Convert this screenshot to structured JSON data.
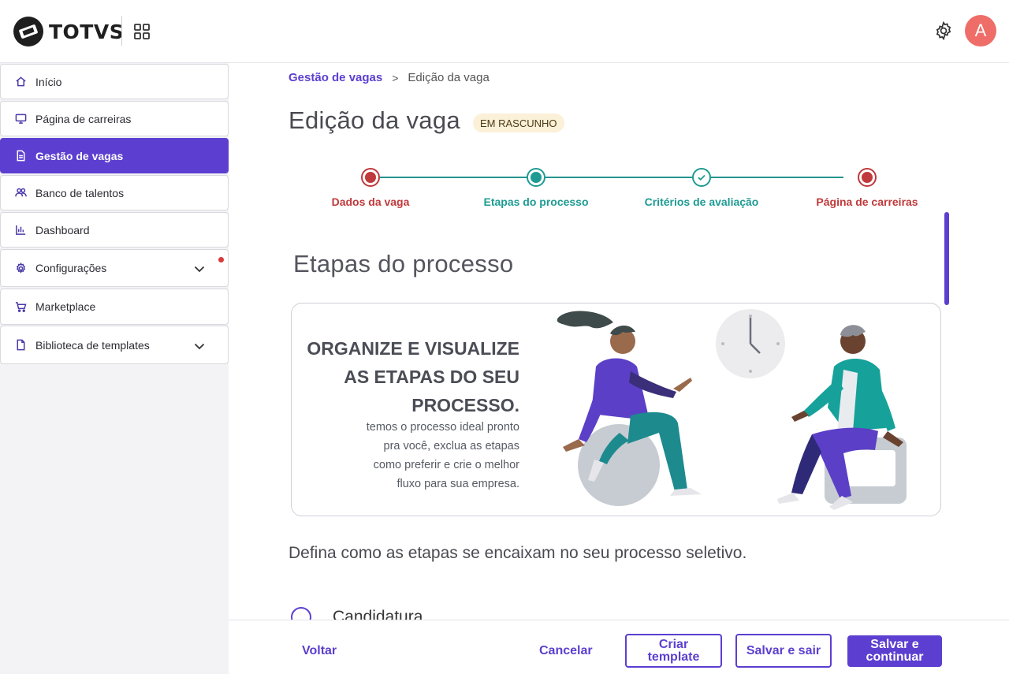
{
  "header": {
    "brand": "TOTVS",
    "avatar_initial": "A"
  },
  "sidebar": {
    "items": [
      {
        "label": "Início",
        "icon": "home-icon"
      },
      {
        "label": "Página de carreiras",
        "icon": "monitor-icon"
      },
      {
        "label": "Gestão de vagas",
        "icon": "document-icon",
        "active": true
      },
      {
        "label": "Banco de talentos",
        "icon": "people-icon"
      },
      {
        "label": "Dashboard",
        "icon": "bar-chart-icon"
      },
      {
        "label": "Configurações",
        "icon": "gear-icon",
        "expandable": true,
        "notification": true
      },
      {
        "label": "Marketplace",
        "icon": "cart-icon"
      },
      {
        "label": "Biblioteca de templates",
        "icon": "file-icon",
        "expandable": true
      }
    ]
  },
  "breadcrumb": {
    "parent": "Gestão de vagas",
    "separator": ">",
    "current": "Edição da vaga"
  },
  "page": {
    "title": "Edição da vaga",
    "status": "EM RASCUNHO"
  },
  "stepper": {
    "steps": [
      {
        "label": "Dados da vaga",
        "state": "error",
        "color": "#c0393b"
      },
      {
        "label": "Etapas do processo",
        "state": "current",
        "color": "#1e9b93"
      },
      {
        "label": "Critérios de avaliação",
        "state": "done",
        "color": "#1e9b93"
      },
      {
        "label": "Página de carreiras",
        "state": "error",
        "color": "#c0393b"
      }
    ]
  },
  "section": {
    "title": "Etapas do processo",
    "banner": {
      "heading_lines": [
        "ORGANIZE E VISUALIZE",
        "AS ETAPAS DO SEU",
        "PROCESSO."
      ],
      "text_lines": [
        "temos o processo ideal pronto",
        "pra você, exclua as etapas",
        "como preferir e crie o melhor",
        "fluxo para sua empresa."
      ]
    },
    "description": "Defina como as etapas se encaixam no seu processo seletivo.",
    "first_stage": "Candidatura"
  },
  "footer": {
    "back": "Voltar",
    "cancel": "Cancelar",
    "create_template": "Criar template",
    "save_exit": "Salvar e sair",
    "save_continue": "Salvar e continuar"
  },
  "colors": {
    "accent": "#5c3fd0",
    "teal": "#1e9b93",
    "error": "#c0393b",
    "badge_bg": "#fbf0d8"
  }
}
